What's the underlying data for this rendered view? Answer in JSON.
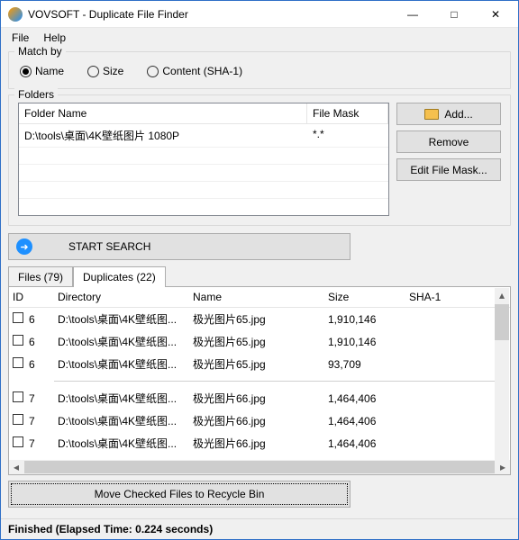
{
  "titlebar": {
    "title": "VOVSOFT - Duplicate File Finder"
  },
  "menu": {
    "file": "File",
    "help": "Help"
  },
  "matchBy": {
    "legend": "Match by",
    "options": {
      "name": "Name",
      "size": "Size",
      "content": "Content (SHA-1)"
    },
    "selected": "name"
  },
  "folders": {
    "legend": "Folders",
    "columns": {
      "name": "Folder Name",
      "mask": "File Mask"
    },
    "rows": [
      {
        "path": "D:\\tools\\桌面\\4K壁纸图片 1080P",
        "mask": "*.*"
      }
    ],
    "buttons": {
      "add": "Add...",
      "remove": "Remove",
      "editMask": "Edit File Mask..."
    }
  },
  "search": {
    "label": "START SEARCH"
  },
  "tabs": {
    "files": "Files (79)",
    "duplicates": "Duplicates (22)"
  },
  "dup": {
    "columns": {
      "id": "ID",
      "dir": "Directory",
      "name": "Name",
      "size": "Size",
      "sha": "SHA-1"
    },
    "groups": [
      {
        "id": "6",
        "rows": [
          {
            "dir": "D:\\tools\\桌面\\4K壁纸图...",
            "name": "极光图片65.jpg",
            "size": "1,910,146"
          },
          {
            "dir": "D:\\tools\\桌面\\4K壁纸图...",
            "name": "极光图片65.jpg",
            "size": "1,910,146"
          },
          {
            "dir": "D:\\tools\\桌面\\4K壁纸图...",
            "name": "极光图片65.jpg",
            "size": "93,709"
          }
        ]
      },
      {
        "id": "7",
        "rows": [
          {
            "dir": "D:\\tools\\桌面\\4K壁纸图...",
            "name": "极光图片66.jpg",
            "size": "1,464,406"
          },
          {
            "dir": "D:\\tools\\桌面\\4K壁纸图...",
            "name": "极光图片66.jpg",
            "size": "1,464,406"
          },
          {
            "dir": "D:\\tools\\桌面\\4K壁纸图...",
            "name": "极光图片66.jpg",
            "size": "1,464,406"
          }
        ]
      }
    ]
  },
  "moveBtn": "Move Checked Files to Recycle Bin",
  "status": "Finished (Elapsed Time: 0.224 seconds)"
}
